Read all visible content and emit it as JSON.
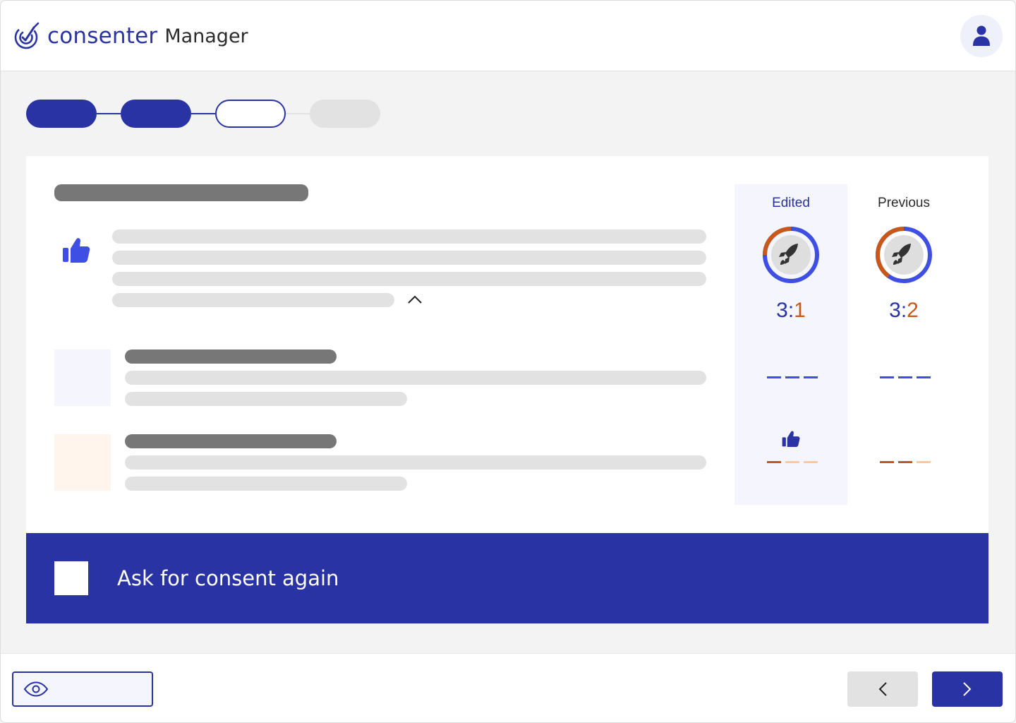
{
  "header": {
    "brand_word": "consenter",
    "brand_sub": "Manager",
    "icons": {
      "logo": "target-check-logo-icon",
      "avatar": "user-icon"
    }
  },
  "stepper": {
    "steps": [
      {
        "state": "done"
      },
      {
        "state": "done"
      },
      {
        "state": "current"
      },
      {
        "state": "todo"
      }
    ]
  },
  "comparison": {
    "columns": [
      {
        "title": "Edited",
        "ratio_left": "3",
        "ratio_sep": ":",
        "ratio_right": "1",
        "donut_fraction_orange": 0.25,
        "icon": "rocket-icon",
        "row1": "dashes-blue",
        "row2": "thumbs-up-icon"
      },
      {
        "title": "Previous",
        "ratio_left": "3",
        "ratio_sep": ":",
        "ratio_right": "2",
        "donut_fraction_orange": 0.4,
        "icon": "rocket-icon",
        "row1": "dashes-blue",
        "row2": "dashes-orange"
      }
    ]
  },
  "consent": {
    "label": "Ask for consent again",
    "checked": false
  },
  "colors": {
    "primary": "#2a33a4",
    "accent_blue": "#3f4ee3",
    "accent_orange": "#c8581a",
    "peach": "#f9c9a4",
    "skeleton_dark": "#777777",
    "skeleton_light": "#e2e2e2"
  },
  "footer": {
    "icons": {
      "preview": "eye-icon",
      "back": "chevron-left-icon",
      "next": "chevron-right-icon"
    }
  }
}
